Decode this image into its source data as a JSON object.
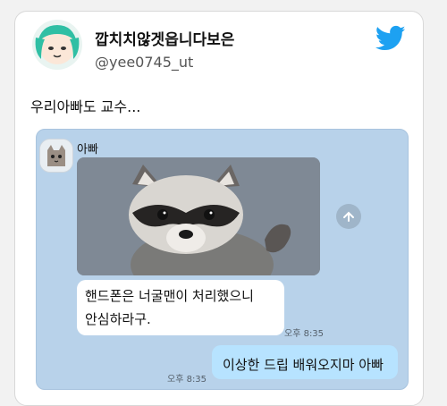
{
  "tweet": {
    "display_name": "깝치치않겟읍니다보은",
    "handle": "@yee0745_ut",
    "text": "우리아빠도 교수..."
  },
  "chat": {
    "sender_name": "아빠",
    "messages": [
      {
        "side": "left",
        "text_line1": "핸드폰은 너굴맨이 처리했으니",
        "text_line2": "안심하라구.",
        "time": "오후 8:35"
      },
      {
        "side": "right",
        "text": "이상한 드립 배워오지마 아빠",
        "time": "오후 8:35"
      }
    ]
  },
  "icons": {
    "brand": "twitter-bird-icon",
    "share": "share-icon",
    "photo": "raccoon-photo",
    "avatar": "anime-avatar"
  },
  "colors": {
    "twitter_blue": "#1da1f2",
    "chat_bg": "#b8d2ea",
    "my_bubble": "#b7e3ff"
  }
}
